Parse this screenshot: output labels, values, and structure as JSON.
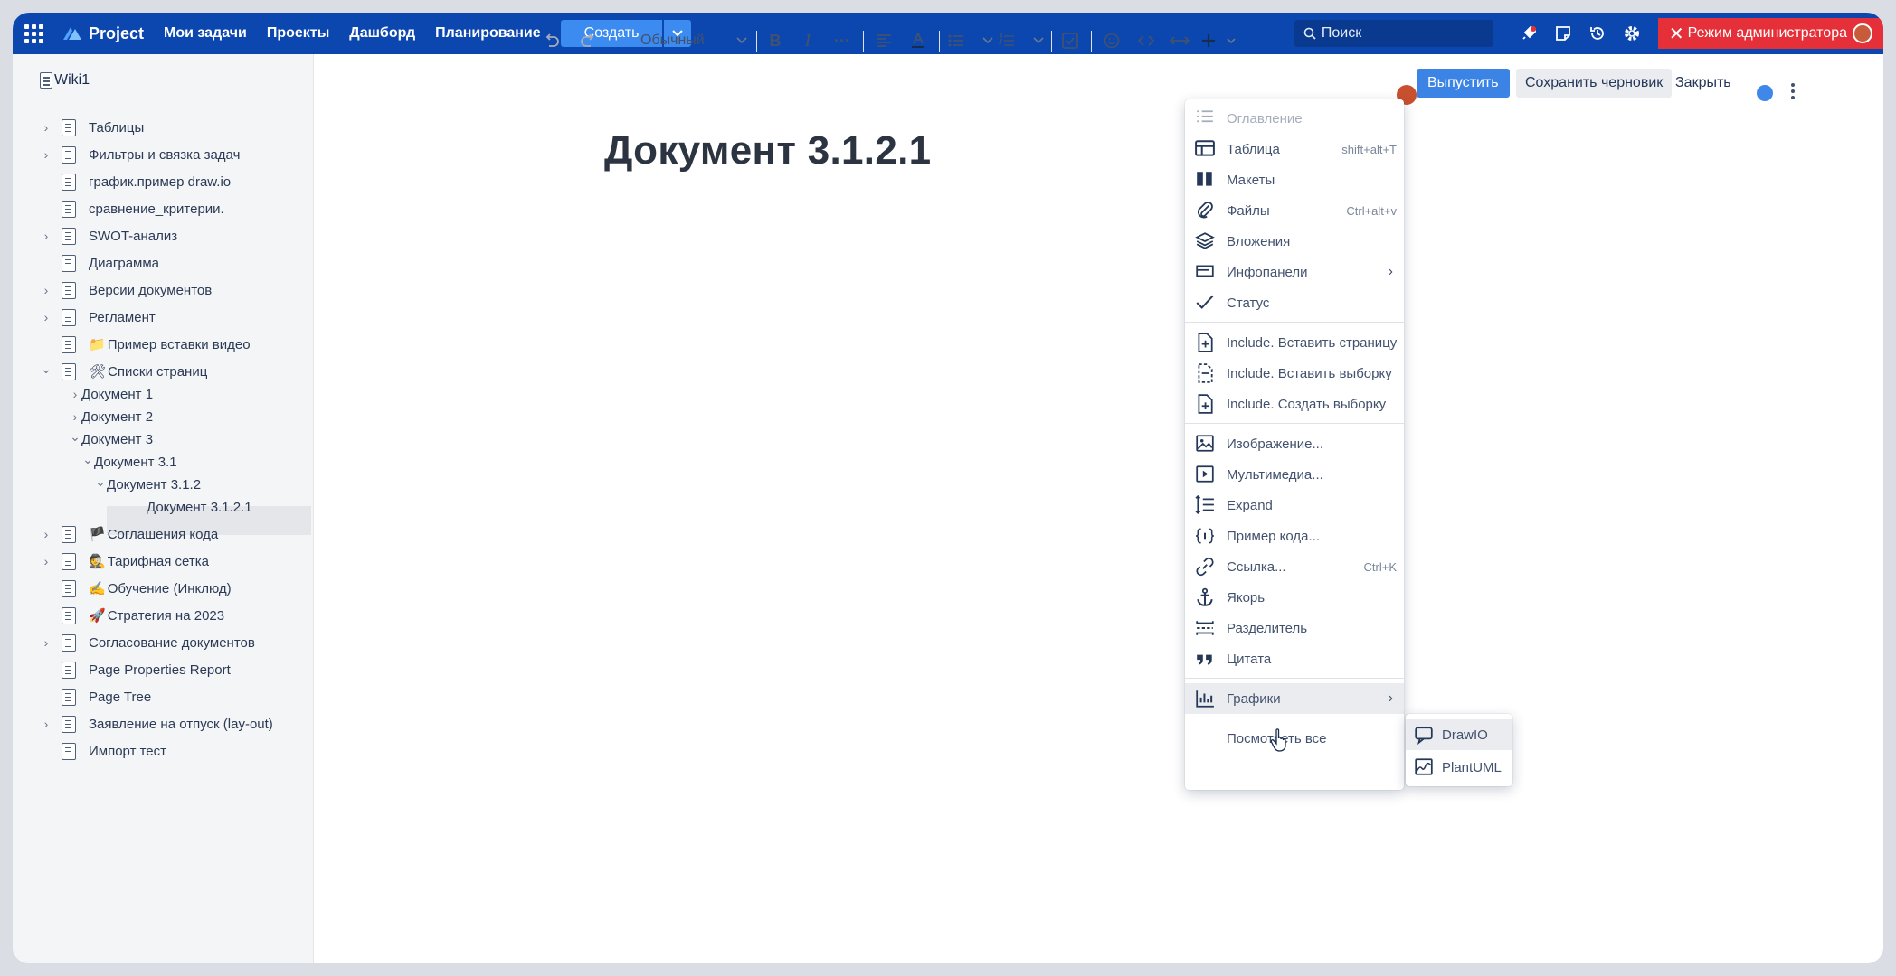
{
  "topbar": {
    "brand": "Project",
    "nav": [
      "Мои задачи",
      "Проекты",
      "Дашборд",
      "Планирование"
    ],
    "create_label": "Создать",
    "search_placeholder": "Поиск",
    "admin_label": "Режим администратора",
    "colors": {
      "bar": "#0c47b0",
      "admin": "#e5303a",
      "accent": "#3b8bf0"
    }
  },
  "sidebar": {
    "space_title": "Wiki1",
    "items": [
      {
        "label": "Таблицы"
      },
      {
        "label": "Фильтры и связка задач"
      },
      {
        "label": "график.пример draw.io"
      },
      {
        "label": "сравнение_критерии."
      },
      {
        "label": "SWOT-анализ"
      },
      {
        "label": "Диаграмма"
      },
      {
        "label": "Версии документов"
      },
      {
        "label": "Регламент"
      },
      {
        "label": "Пример вставки видео",
        "emoji": "📁"
      },
      {
        "label": "Списки страниц",
        "emoji": "🛠"
      },
      {
        "label": "Документ 1"
      },
      {
        "label": "Документ 2"
      },
      {
        "label": "Документ 3"
      },
      {
        "label": "Документ 3.1"
      },
      {
        "label": "Документ 3.1.2"
      },
      {
        "label": "Документ 3.1.2.1"
      },
      {
        "label": "Соглашения кода",
        "emoji": "🏴"
      },
      {
        "label": "Тарифная сетка",
        "emoji": "🕵"
      },
      {
        "label": "Обучение (Инклюд)",
        "emoji": "✍"
      },
      {
        "label": "Стратегия на 2023",
        "emoji": "🚀"
      },
      {
        "label": "Согласование документов"
      },
      {
        "label": "Page Properties Report"
      },
      {
        "label": "Page Tree"
      },
      {
        "label": "Заявление на отпуск (lay-out)"
      },
      {
        "label": "Импорт тест"
      }
    ]
  },
  "editor": {
    "paragraph_style": "Обычный",
    "publish_label": "Выпустить",
    "save_draft_label": "Сохранить черновик",
    "close_label": "Закрыть",
    "document_title": "Документ 3.1.2.1"
  },
  "insert_menu": {
    "items": [
      {
        "label": "Оглавление",
        "icon": "toc-icon"
      },
      {
        "label": "Таблица",
        "icon": "table-icon",
        "shortcut": "shift+alt+T"
      },
      {
        "label": "Макеты",
        "icon": "layouts-icon"
      },
      {
        "label": "Файлы",
        "icon": "paperclip-icon",
        "shortcut": "Ctrl+alt+v"
      },
      {
        "label": "Вложения",
        "icon": "layers-icon"
      },
      {
        "label": "Инфопанели",
        "icon": "panel-icon"
      },
      {
        "label": "Статус",
        "icon": "check-icon"
      },
      {
        "label": "Include. Вставить страницу",
        "icon": "include-page-icon"
      },
      {
        "label": "Include. Вставить выборку",
        "icon": "include-excerpt-icon"
      },
      {
        "label": "Include. Создать выборку",
        "icon": "create-excerpt-icon"
      },
      {
        "label": "Изображение...",
        "icon": "image-icon"
      },
      {
        "label": "Мультимедиа...",
        "icon": "media-icon"
      },
      {
        "label": "Expand",
        "icon": "expand-icon"
      },
      {
        "label": "Пример кода...",
        "icon": "code-icon"
      },
      {
        "label": "Ссылка...",
        "icon": "link-icon",
        "shortcut": "Ctrl+K"
      },
      {
        "label": "Якорь",
        "icon": "anchor-icon"
      },
      {
        "label": "Разделитель",
        "icon": "divider-icon"
      },
      {
        "label": "Цитата",
        "icon": "quote-icon"
      },
      {
        "label": "Графики",
        "icon": "chart-icon"
      },
      {
        "label": "Посмотреть все"
      }
    ]
  },
  "charts_submenu": {
    "items": [
      {
        "label": "DrawIO",
        "icon": "drawio-icon"
      },
      {
        "label": "PlantUML",
        "icon": "plantuml-icon"
      }
    ]
  }
}
